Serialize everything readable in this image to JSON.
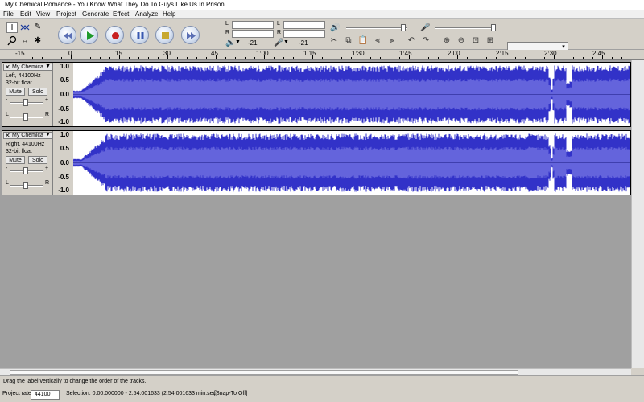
{
  "window": {
    "title": "My Chemical Romance - You Know What They Do To Guys Like Us In Prison"
  },
  "menu": [
    "File",
    "Edit",
    "View",
    "Project",
    "Generate",
    "Effect",
    "Analyze",
    "Help"
  ],
  "tools": [
    "selection-tool",
    "envelope-tool",
    "draw-tool",
    "zoom-tool",
    "time-shift-tool",
    "multi-tool"
  ],
  "transport": [
    "skip-to-start",
    "play",
    "record",
    "pause",
    "stop",
    "skip-to-end"
  ],
  "meters": {
    "L": "L",
    "R": "R",
    "playback_db": "-21",
    "record_db": "-21"
  },
  "ruler": {
    "labels": [
      "-15",
      "0",
      "15",
      "30",
      "45",
      "1:00",
      "1:15",
      "1:30",
      "1:45",
      "2:00",
      "2:15",
      "2:30",
      "2:45"
    ]
  },
  "tracks": [
    {
      "name": "My Chemica",
      "channel": "Left, 44100Hz",
      "format": "32-bit float",
      "mute": "Mute",
      "solo": "Solo",
      "gain_minus": "-",
      "gain_plus": "+",
      "pan_l": "L",
      "pan_r": "R",
      "scale": [
        "1.0",
        "0.5",
        "0.0",
        "-0.5",
        "-1.0"
      ]
    },
    {
      "name": "My Chemica",
      "channel": "Right, 44100Hz",
      "format": "32-bit float",
      "mute": "Mute",
      "solo": "Solo",
      "gain_minus": "-",
      "gain_plus": "+",
      "pan_l": "L",
      "pan_r": "R",
      "scale": [
        "1.0",
        "0.5",
        "0.0",
        "-0.5",
        "-1.0"
      ]
    }
  ],
  "status": {
    "hint": "Drag the label vertically to change the order of the tracks."
  },
  "bottom": {
    "project_rate_label": "Project rate:",
    "project_rate": "44100",
    "selection": "Selection: 0:00.000000 - 2:54.001633 (2:54.001633 min:sec)",
    "snap": "[Snap-To Off]"
  },
  "colors": {
    "waveform": "#3232c8",
    "waveform_rms": "#6464dc",
    "background": "#d4d0c8",
    "workspace": "#a0a0a0"
  }
}
